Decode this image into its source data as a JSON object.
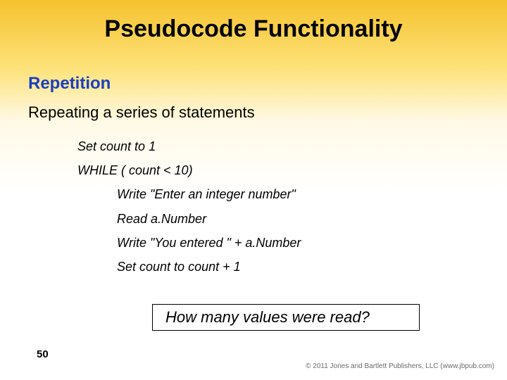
{
  "title": "Pseudocode Functionality",
  "subheading": "Repetition",
  "body_text": "Repeating a series of statements",
  "code": {
    "l1": "Set count to 1",
    "l2": "WHILE ( count < 10)",
    "l3": "Write \"Enter an integer number\"",
    "l4": "Read a.Number",
    "l5": "Write \"You entered \" + a.Number",
    "l6": "Set count to count + 1"
  },
  "question": "How many values were read?",
  "slide_number": "50",
  "footer": "© 2011 Jones and Bartlett Publishers, LLC (www.jbpub.com)"
}
